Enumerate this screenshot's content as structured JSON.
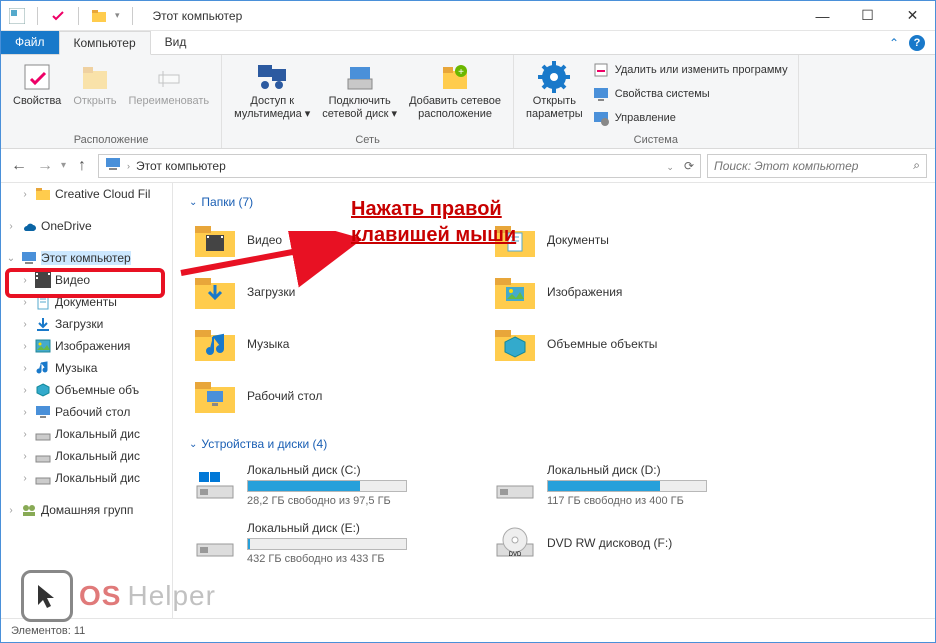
{
  "title": "Этот компьютер",
  "tabs": {
    "file": "Файл",
    "computer": "Компьютер",
    "view": "Вид"
  },
  "ribbon": {
    "location": {
      "label": "Расположение",
      "properties": "Свойства",
      "open": "Открыть",
      "rename": "Переименовать"
    },
    "network": {
      "label": "Сеть",
      "media_ln1": "Доступ к",
      "media_ln2": "мультимедиа",
      "map_ln1": "Подключить",
      "map_ln2": "сетевой диск",
      "addnet_ln1": "Добавить сетевое",
      "addnet_ln2": "расположение"
    },
    "system": {
      "label": "Система",
      "settings_ln1": "Открыть",
      "settings_ln2": "параметры",
      "uninstall": "Удалить или изменить программу",
      "sysprops": "Свойства системы",
      "manage": "Управление"
    }
  },
  "address": {
    "path": "Этот компьютер",
    "search_placeholder": "Поиск: Этот компьютер"
  },
  "sidebar": {
    "items": [
      {
        "label": "Creative Cloud Fil",
        "chev": ">"
      },
      {
        "label": "OneDrive",
        "chev": ">"
      },
      {
        "label": "Этот компьютер",
        "chev": "v"
      },
      {
        "label": "Видео",
        "chev": ">"
      },
      {
        "label": "Документы",
        "chev": ">"
      },
      {
        "label": "Загрузки",
        "chev": ">"
      },
      {
        "label": "Изображения",
        "chev": ">"
      },
      {
        "label": "Музыка",
        "chev": ">"
      },
      {
        "label": "Объемные объ",
        "chev": ">"
      },
      {
        "label": "Рабочий стол",
        "chev": ">"
      },
      {
        "label": "Локальный дис",
        "chev": ">"
      },
      {
        "label": "Локальный дис",
        "chev": ">"
      },
      {
        "label": "Локальный дис",
        "chev": ">"
      },
      {
        "label": "Домашняя групп",
        "chev": ">"
      }
    ]
  },
  "sections": {
    "folders": "Папки (7)",
    "drives": "Устройства и диски (4)"
  },
  "folders": [
    {
      "label": "Видео"
    },
    {
      "label": "Документы"
    },
    {
      "label": "Загрузки"
    },
    {
      "label": "Изображения"
    },
    {
      "label": "Музыка"
    },
    {
      "label": "Объемные объекты"
    },
    {
      "label": "Рабочий стол"
    }
  ],
  "drives": [
    {
      "name": "Локальный диск (C:)",
      "free": "28,2 ГБ свободно из 97,5 ГБ",
      "pct": 71
    },
    {
      "name": "Локальный диск (D:)",
      "free": "117 ГБ свободно из 400 ГБ",
      "pct": 71
    },
    {
      "name": "Локальный диск (E:)",
      "free": "432 ГБ свободно из 433 ГБ",
      "pct": 1
    },
    {
      "name": "DVD RW дисковод (F:)",
      "free": "",
      "pct": null
    }
  ],
  "status": "Элементов: 11",
  "annotation": {
    "ln1": "Нажать правой",
    "ln2": "клавишей мыши"
  },
  "watermark": {
    "t1": "OS",
    "t2": "Helper"
  }
}
